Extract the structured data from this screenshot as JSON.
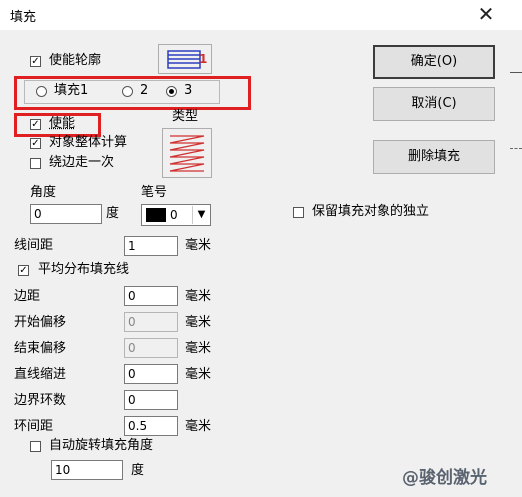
{
  "window": {
    "title": "填充",
    "close_glyph": "✕"
  },
  "options": {
    "enable_outline": {
      "label": "使能轮廓",
      "checked": true
    },
    "fill_radios": [
      {
        "label": "填充1",
        "selected": false
      },
      {
        "label": "2",
        "selected": false
      },
      {
        "label": "3",
        "selected": true
      }
    ],
    "enable": {
      "label": "使能",
      "checked": true
    },
    "whole_object_calc": {
      "label": "对象整体计算",
      "checked": true
    },
    "walk_edge_once": {
      "label": "绕边走一次",
      "checked": false
    },
    "type_label": "类型",
    "outline_pen_number": "1"
  },
  "angle": {
    "label": "角度",
    "value": "0",
    "unit": "度"
  },
  "pen": {
    "label": "笔号",
    "value": "0",
    "color": "#000000"
  },
  "line_spacing": {
    "label": "线间距",
    "value": "1",
    "unit": "毫米"
  },
  "even_distribute": {
    "label": "平均分布填充线",
    "checked": true
  },
  "fields": [
    {
      "label": "边距",
      "value": "0",
      "unit": "毫米",
      "disabled": false
    },
    {
      "label": "开始偏移",
      "value": "0",
      "unit": "毫米",
      "disabled": true
    },
    {
      "label": "结束偏移",
      "value": "0",
      "unit": "毫米",
      "disabled": true
    },
    {
      "label": "直线缩进",
      "value": "0",
      "unit": "毫米",
      "disabled": false
    },
    {
      "label": "边界环数",
      "value": "0",
      "unit": "",
      "disabled": false
    },
    {
      "label": "环间距",
      "value": "0.5",
      "unit": "毫米",
      "disabled": false
    }
  ],
  "auto_rotate": {
    "label": "自动旋转填充角度",
    "checked": false,
    "value": "10",
    "unit": "度"
  },
  "buttons": {
    "ok": "确定(O)",
    "cancel": "取消(C)",
    "delete_fill": "删除填充"
  },
  "keep_independent": {
    "label": "保留填充对象的独立",
    "checked": false
  },
  "watermark": "@骏创激光",
  "colors": {
    "highlight": "#e02020",
    "icon_blue": "#2a3fbf",
    "icon_red": "#d03030",
    "dialog_bg": "#f0f0f0"
  }
}
